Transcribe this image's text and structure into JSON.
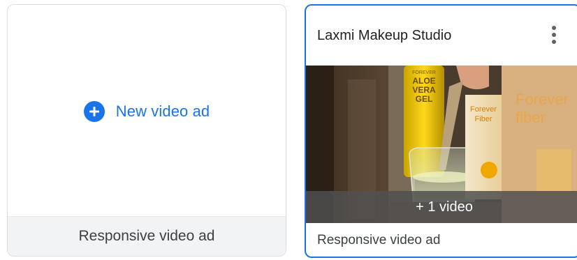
{
  "new_card": {
    "action_label": "New video ad",
    "footer_label": "Responsive video ad",
    "accent_color": "#1a73e8"
  },
  "ad_card": {
    "title": "Laxmi Makeup Studio",
    "thumbnail_caption": "+ 1 video",
    "footer_label": "Responsive video ad",
    "menu_icon": "more-vert-icon",
    "thumbnail_texts": {
      "bottle_brand": "FOREVER",
      "bottle_line1": "ALOE",
      "bottle_line2": "VERA",
      "bottle_line3": "GEL",
      "box_brand1": "Forever",
      "box_brand2": "Fiber",
      "bg_brand1": "Forever",
      "bg_brand2": "fiber"
    }
  }
}
